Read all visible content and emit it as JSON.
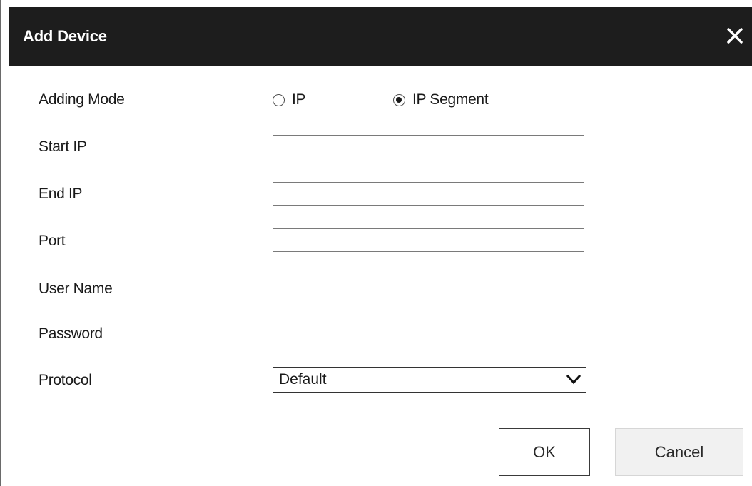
{
  "dialog": {
    "title": "Add Device",
    "close_icon": "close-icon"
  },
  "form": {
    "adding_mode": {
      "label": "Adding Mode",
      "options": [
        {
          "label": "IP",
          "checked": false
        },
        {
          "label": "IP Segment",
          "checked": true
        }
      ]
    },
    "start_ip": {
      "label": "Start IP",
      "value": ""
    },
    "end_ip": {
      "label": "End IP",
      "value": ""
    },
    "port": {
      "label": "Port",
      "value": ""
    },
    "user_name": {
      "label": "User Name",
      "value": ""
    },
    "password": {
      "label": "Password",
      "value": ""
    },
    "protocol": {
      "label": "Protocol",
      "value": "Default",
      "arrow_icon": "chevron-down-icon"
    }
  },
  "buttons": {
    "ok": "OK",
    "cancel": "Cancel"
  },
  "colors": {
    "titlebar_bg": "#1d1d1d",
    "titlebar_text": "#ffffff",
    "cancel_bg": "#f1f1f1"
  }
}
